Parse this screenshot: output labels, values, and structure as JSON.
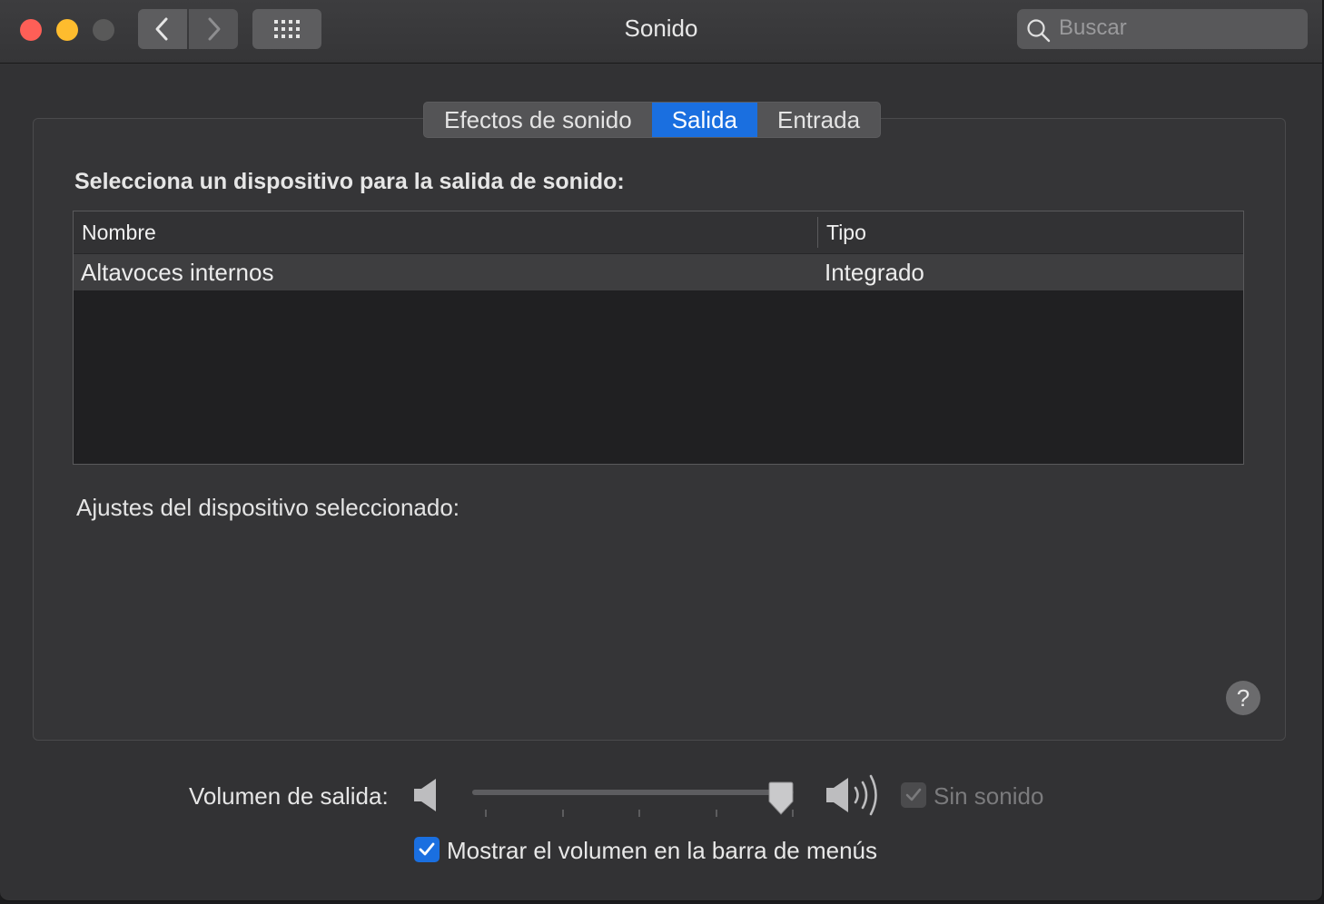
{
  "window": {
    "title": "Sonido",
    "search_placeholder": "Buscar"
  },
  "tabs": [
    {
      "label": "Efectos de sonido",
      "selected": false
    },
    {
      "label": "Salida",
      "selected": true
    },
    {
      "label": "Entrada",
      "selected": false
    }
  ],
  "output": {
    "heading": "Selecciona un dispositivo para la salida de sonido:",
    "columns": [
      "Nombre",
      "Tipo"
    ],
    "rows": [
      {
        "name": "Altavoces internos",
        "type": "Integrado",
        "selected": true
      }
    ],
    "settings_label": "Ajustes del dispositivo seleccionado:"
  },
  "help_label": "?",
  "volume": {
    "label": "Volumen de salida:",
    "level": 0.96,
    "mute_label": "Sin sonido",
    "mute_checked": true,
    "mute_enabled": false,
    "show_in_menubar_label": "Mostrar el volumen en la barra de menús",
    "show_in_menubar_checked": true
  },
  "colors": {
    "accent": "#1a6fe0",
    "close": "#fe5f57",
    "minimize": "#febc2e"
  }
}
